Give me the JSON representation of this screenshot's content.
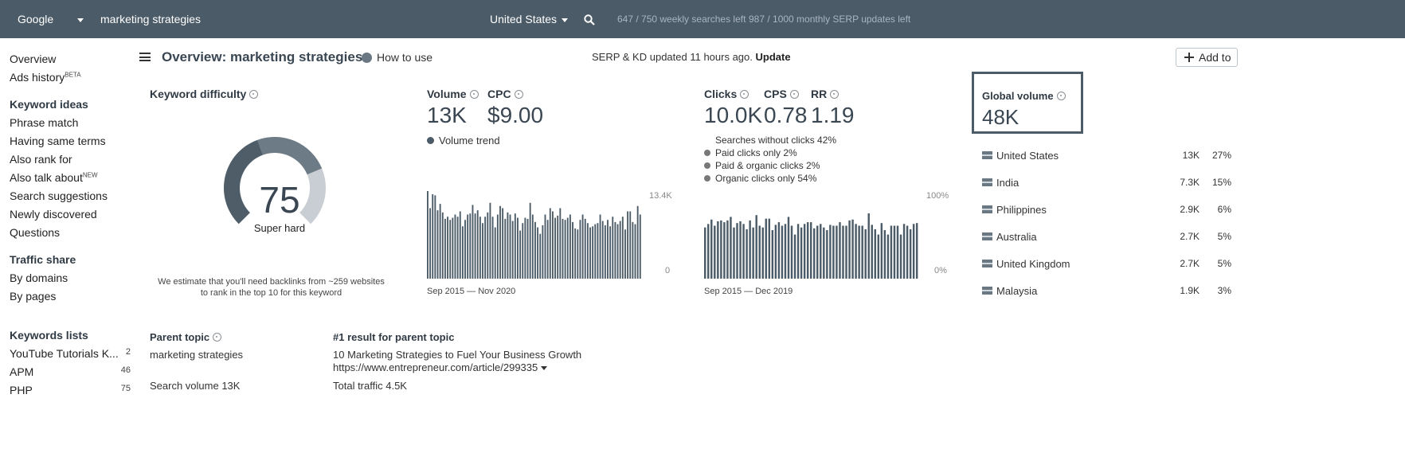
{
  "topbar": {
    "engine": "Google",
    "query": "marketing strategies",
    "country": "United States",
    "faint_1": "647 / 750 weekly searches left",
    "faint_2": "987 / 1000 monthly SERP updates left"
  },
  "sidebar": {
    "overview": "Overview",
    "ads_history": "Ads history",
    "ads_history_badge": "BETA",
    "keyword_ideas_head": "Keyword ideas",
    "ideas": [
      "Phrase match",
      "Having same terms",
      "Also rank for",
      "Also talk about",
      "Search suggestions",
      "Newly discovered",
      "Questions"
    ],
    "also_talk_badge": "NEW",
    "traffic_share_head": "Traffic share",
    "traffic": [
      "By domains",
      "By pages"
    ],
    "keywords_lists_head": "Keywords lists",
    "lists": [
      {
        "name": "YouTube Tutorials K...",
        "count": "2"
      },
      {
        "name": "APM",
        "count": "46"
      },
      {
        "name": "PHP",
        "count": "75"
      }
    ]
  },
  "header": {
    "title": "Overview: marketing strategies",
    "how_to_use": "How to use",
    "serp_status": "SERP & KD updated 11 hours ago.",
    "update": "Update",
    "add_to": "Add to"
  },
  "kd": {
    "label": "Keyword difficulty",
    "value": 75,
    "value_text": "75",
    "rating": "Super hard",
    "note_line1": "We estimate that you'll need backlinks from ~259 websites",
    "note_line2": "to rank in the top 10 for this keyword"
  },
  "volume": {
    "label": "Volume",
    "value": "13K",
    "cpc_label": "CPC",
    "cpc_value": "$9.00",
    "legend": "Volume trend",
    "axis_top": "13.4K",
    "axis_bottom": "0",
    "range": "Sep 2015 — Nov 2020"
  },
  "clicks": {
    "clicks_label": "Clicks",
    "clicks_value": "10.0K",
    "cps_label": "CPS",
    "cps_value": "0.78",
    "rr_label": "RR",
    "rr_value": "1.19",
    "without_clicks": "Searches without clicks 42%",
    "paid_only": "Paid clicks only 2%",
    "paid_organic": "Paid & organic clicks 2%",
    "organic_only": "Organic clicks only 54%",
    "axis_top": "100%",
    "axis_bottom": "0%",
    "range": "Sep 2015 — Dec 2019"
  },
  "global": {
    "label": "Global volume",
    "value": "48K",
    "countries": [
      {
        "name": "United States",
        "volume": "13K",
        "share": "27%"
      },
      {
        "name": "India",
        "volume": "7.3K",
        "share": "15%"
      },
      {
        "name": "Philippines",
        "volume": "2.9K",
        "share": "6%"
      },
      {
        "name": "Australia",
        "volume": "2.7K",
        "share": "5%"
      },
      {
        "name": "United Kingdom",
        "volume": "2.7K",
        "share": "5%"
      },
      {
        "name": "Malaysia",
        "volume": "1.9K",
        "share": "3%"
      }
    ]
  },
  "parent": {
    "label": "Parent topic",
    "topic": "marketing strategies",
    "search_volume": "Search volume 13K",
    "result_label": "#1 result for parent topic",
    "result_title": "10 Marketing Strategies to Fuel Your Business Growth",
    "result_url": "https://www.entrepreneur.com/article/299335",
    "total_traffic": "Total traffic 4.5K"
  },
  "colors": {
    "topbar": "#4b5b67",
    "bars": "#4b5b67",
    "gauge_fill": "#4f5d69",
    "gauge_track": "#c8ced3"
  },
  "chart_data": [
    {
      "type": "bar",
      "series": [
        {
          "name": "Volume trend",
          "values": [
            0.82,
            0.66,
            0.79,
            0.78,
            0.64,
            0.7,
            0.62,
            0.56,
            0.58,
            0.55,
            0.57,
            0.6,
            0.58,
            0.63,
            0.49,
            0.55,
            0.6,
            0.61,
            0.69,
            0.61,
            0.64,
            0.58,
            0.52,
            0.58,
            0.62,
            0.71,
            0.58,
            0.48,
            0.6,
            0.68,
            0.66,
            0.56,
            0.62,
            0.6,
            0.54,
            0.61,
            0.57,
            0.45,
            0.52,
            0.57,
            0.56,
            0.71,
            0.6,
            0.53,
            0.48,
            0.42,
            0.5,
            0.6,
            0.55,
            0.66,
            0.63,
            0.57,
            0.59,
            0.66,
            0.56,
            0.55,
            0.57,
            0.6,
            0.53,
            0.47,
            0.46,
            0.55,
            0.6,
            0.56,
            0.52,
            0.48,
            0.49,
            0.51,
            0.52,
            0.6,
            0.54,
            0.5,
            0.55,
            0.49,
            0.58,
            0.53,
            0.51,
            0.54,
            0.58,
            0.46,
            0.63,
            0.63,
            0.53,
            0.51,
            0.68,
            0.6
          ]
        }
      ],
      "ylim": [
        0,
        13400
      ],
      "xlabel": "",
      "ylabel": ""
    },
    {
      "type": "bar",
      "series": [
        {
          "name": "Clicks",
          "values": [
            0.58,
            0.62,
            0.67,
            0.6,
            0.65,
            0.66,
            0.64,
            0.66,
            0.7,
            0.58,
            0.63,
            0.65,
            0.62,
            0.56,
            0.66,
            0.58,
            0.72,
            0.6,
            0.58,
            0.68,
            0.68,
            0.55,
            0.61,
            0.64,
            0.6,
            0.62,
            0.7,
            0.6,
            0.5,
            0.62,
            0.58,
            0.62,
            0.64,
            0.64,
            0.57,
            0.6,
            0.62,
            0.58,
            0.55,
            0.61,
            0.6,
            0.6,
            0.64,
            0.6,
            0.6,
            0.66,
            0.67,
            0.62,
            0.6,
            0.6,
            0.56,
            0.74,
            0.61,
            0.56,
            0.5,
            0.63,
            0.55,
            0.5,
            0.6,
            0.6,
            0.6,
            0.5,
            0.62,
            0.6,
            0.56,
            0.62,
            0.63
          ]
        }
      ],
      "ylim": [
        0,
        100
      ],
      "xlabel": "",
      "ylabel": ""
    }
  ]
}
